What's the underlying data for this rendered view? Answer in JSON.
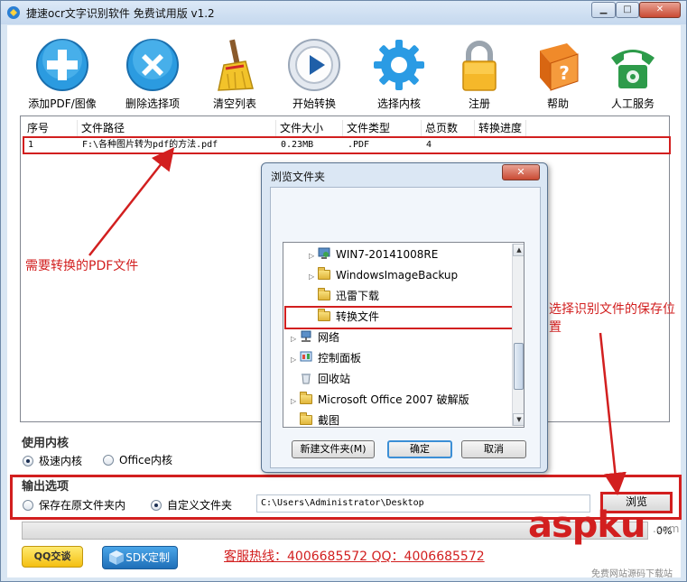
{
  "window": {
    "title": "捷速ocr文字识别软件 免费试用版 v1.2",
    "min_label": "▁",
    "max_label": "□",
    "close_label": "✕"
  },
  "toolbar": [
    {
      "label": "添加PDF/图像",
      "icon": "add-icon"
    },
    {
      "label": "删除选择项",
      "icon": "delete-icon"
    },
    {
      "label": "清空列表",
      "icon": "broom-icon"
    },
    {
      "label": "开始转换",
      "icon": "play-icon"
    },
    {
      "label": "选择内核",
      "icon": "gear-icon"
    },
    {
      "label": "注册",
      "icon": "lock-icon"
    },
    {
      "label": "帮助",
      "icon": "help-book-icon"
    },
    {
      "label": "人工服务",
      "icon": "telephone-icon"
    }
  ],
  "file_list": {
    "columns": [
      "序号",
      "文件路径",
      "文件大小",
      "文件类型",
      "总页数",
      "转换进度"
    ],
    "rows": [
      {
        "index": "1",
        "path": "F:\\各种图片转为pdf的方法.pdf",
        "size": "0.23MB",
        "type": ".PDF",
        "pages": "4",
        "progress": ""
      }
    ]
  },
  "kernel": {
    "title": "使用内核",
    "options": [
      {
        "label": "极速内核",
        "selected": true
      },
      {
        "label": "Office内核",
        "selected": false
      }
    ]
  },
  "output": {
    "title": "输出选项",
    "options": [
      {
        "label": "保存在原文件夹内",
        "selected": false
      },
      {
        "label": "自定义文件夹",
        "selected": true
      }
    ],
    "path": "C:\\Users\\Administrator\\Desktop",
    "browse_label": "浏览"
  },
  "progress": {
    "percent_text": "0%",
    "value": 0
  },
  "footer": {
    "qq_label": "QQ交谈",
    "sdk_label": "SDK定制",
    "hotline": "客服热线：4006685572 QQ：4006685572"
  },
  "watermark": {
    "main": "aspku",
    "suffix": ".com",
    "sub": "免费网站源码下载站"
  },
  "annotations": {
    "left": "需要转换的PDF文件",
    "right": "选择识别文件的保存位置"
  },
  "dialog": {
    "title": "浏览文件夹",
    "close_label": "✕",
    "tree": [
      {
        "label": "WIN7-20141008RE",
        "icon": "computer-icon",
        "expander": "▷"
      },
      {
        "label": "WindowsImageBackup",
        "icon": "folder-icon",
        "expander": "▷"
      },
      {
        "label": "迅雷下载",
        "icon": "folder-icon",
        "expander": ""
      },
      {
        "label": "转换文件",
        "icon": "folder-icon",
        "expander": ""
      },
      {
        "label": "网络",
        "icon": "network-icon",
        "expander": "▷"
      },
      {
        "label": "控制面板",
        "icon": "control-panel-icon",
        "expander": "▷"
      },
      {
        "label": "回收站",
        "icon": "recycle-bin-icon",
        "expander": ""
      },
      {
        "label": "Microsoft Office 2007 破解版",
        "icon": "folder-icon",
        "expander": "▷"
      },
      {
        "label": "截图",
        "icon": "folder-icon",
        "expander": ""
      }
    ],
    "new_folder_label": "新建文件夹(M)",
    "ok_label": "确定",
    "cancel_label": "取消"
  },
  "colors": {
    "annotation_red": "#d21f1f",
    "title_bg": "#c5d8ee",
    "progress_green": "#36b54a"
  }
}
